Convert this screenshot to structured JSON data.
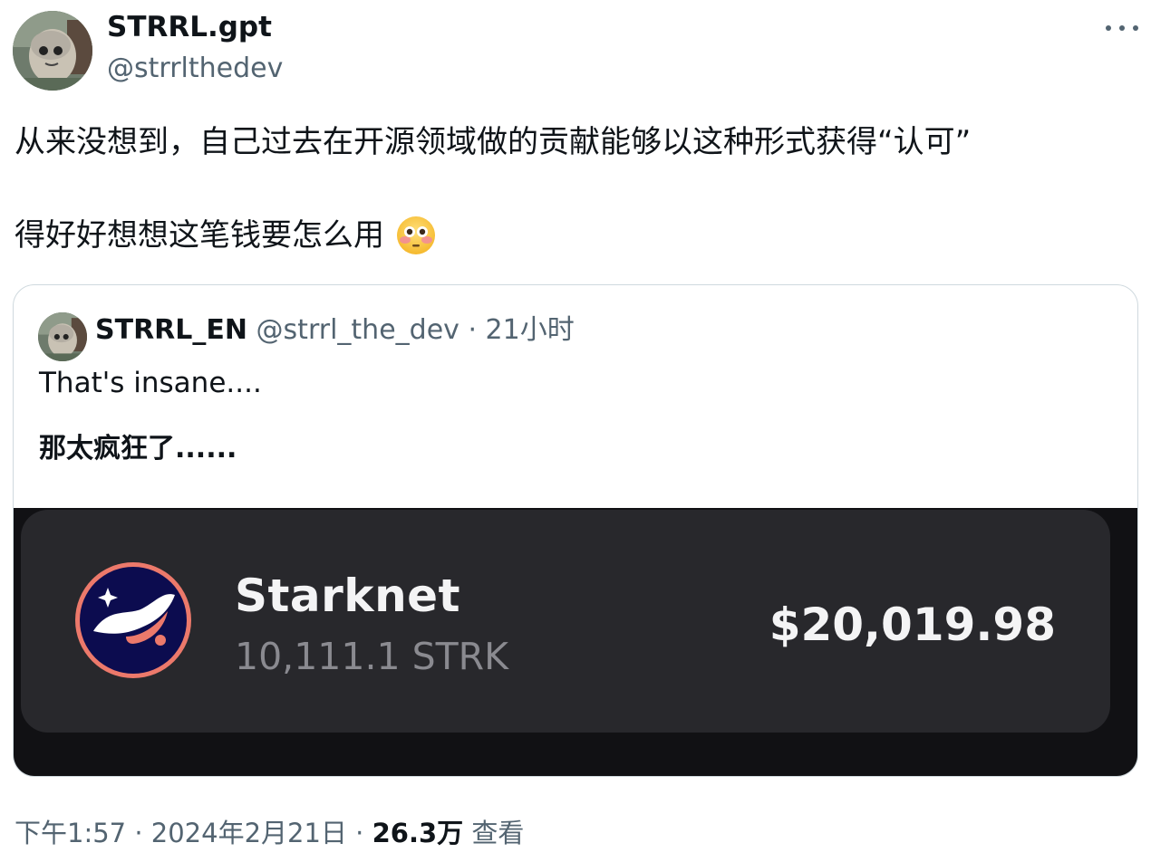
{
  "author": {
    "name": "STRRL.gpt",
    "handle": "@strrlthedev"
  },
  "tweet": {
    "line1": "从来没想到，自己过去在开源领域做的贡献能够以这种形式获得“认可”",
    "line2": "得好好想想这笔钱要怎么用",
    "emoji_icon": "flushed-face-emoji"
  },
  "quoted": {
    "name": "STRRL_EN",
    "handle": "@strrl_the_dev",
    "separator": "·",
    "time": "21小时",
    "text_en": "That's insane....",
    "text_zh": "那太疯狂了......",
    "media": {
      "asset_name": "Starknet",
      "asset_amount": "10,111.1 STRK",
      "asset_value": "$20,019.98"
    }
  },
  "footer": {
    "time": "下午1:57",
    "sep1": "·",
    "date": "2024年2月21日",
    "sep2": "·",
    "views_count": "26.3万",
    "views_label": "查看"
  },
  "colors": {
    "text_primary": "#0f1419",
    "text_secondary": "#536471",
    "border": "#cfd9de",
    "starknet_navy": "#0c0c4f",
    "starknet_orange": "#ec796b"
  }
}
